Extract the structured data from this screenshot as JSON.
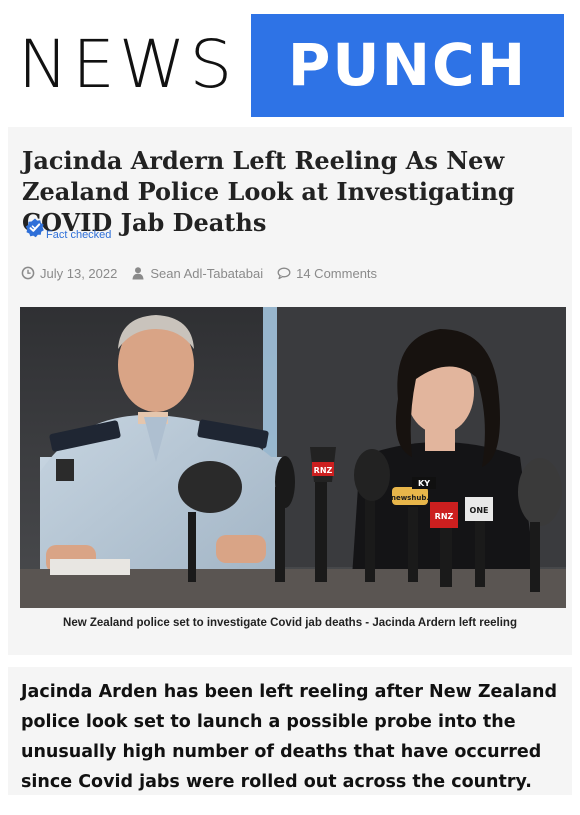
{
  "masthead": {
    "logo_left": "NEWS",
    "logo_right": "PUNCH",
    "brand_color": "#2e73e6"
  },
  "article": {
    "headline": "Jacinda Ardern Left Reeling As New Zealand Police Look at Investigating COVID Jab Deaths",
    "fact_check_label": "Fact checked",
    "meta": {
      "date": "July 13, 2022",
      "author": "Sean Adl-Tabatabai",
      "comments": "14 Comments"
    },
    "photo": {
      "mic_labels": [
        "RNZ",
        "newshub.",
        "RNZ",
        "ONE",
        "KY"
      ]
    },
    "caption": "New Zealand police set to investigate Covid jab deaths - Jacinda Ardern left reeling",
    "lead": "Jacinda Arden has been left reeling after New Zealand police look set to launch a possible probe into the unusually high number of deaths that have occurred since Covid jabs were rolled out across the country."
  },
  "icons": {
    "fact": "verified-check-icon",
    "date": "clock-icon",
    "author": "user-icon",
    "comments": "speech-bubble-icon"
  }
}
